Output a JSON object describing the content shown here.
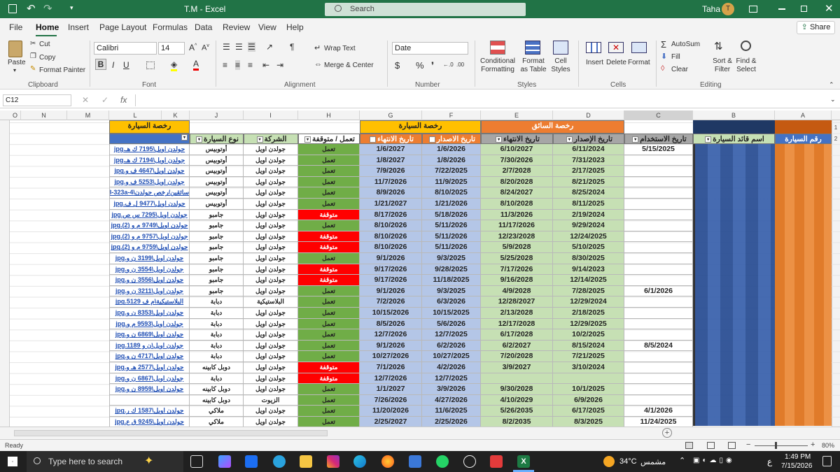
{
  "window": {
    "title": "T.M - Excel",
    "search_placeholder": "Search",
    "user": "Taha",
    "avatar": "T"
  },
  "menu": [
    "File",
    "Home",
    "Insert",
    "Page Layout",
    "Formulas",
    "Data",
    "Review",
    "View",
    "Help"
  ],
  "share": "Share",
  "ribbon": {
    "paste": "Paste",
    "cut": "Cut",
    "copy": "Copy",
    "format_painter": "Format Painter",
    "clipboard": "Clipboard",
    "font_name": "Calibri",
    "font_size": "14",
    "font": "Font",
    "wrap_text": "Wrap Text",
    "merge_center": "Merge & Center",
    "alignment": "Alignment",
    "number_format": "Date",
    "number": "Number",
    "cond_format": "Conditional Formatting",
    "format_table": "Format as Table",
    "cell_styles": "Cell Styles",
    "styles": "Styles",
    "insert": "Insert",
    "delete": "Delete",
    "format": "Format",
    "cells": "Cells",
    "autosum": "AutoSum",
    "fill": "Fill",
    "clear": "Clear",
    "sort_filter": "Sort & Filter",
    "find_select": "Find & Select",
    "editing": "Editing"
  },
  "formula_bar": {
    "name_box": "C12",
    "fx": "fx",
    "content": ""
  },
  "columns": [
    "O",
    "N",
    "M",
    "L",
    "K",
    "J",
    "I",
    "H",
    "G",
    "F",
    "E",
    "D",
    "C",
    "B",
    "A"
  ],
  "row_numbers": [
    "1",
    "2"
  ],
  "headers": {
    "car_license_L": "رخصة السيارة",
    "car_license_G": "رخصة السيارة",
    "driver_license": "رخصة السائق",
    "car_type": "نوع السيارة",
    "company": "الشركة",
    "status": "تعمل / متوقفة",
    "expiry": "تاريخ الانتهاء",
    "issue": "تاريخ الاصدار",
    "driver_expiry": "تاريخ الانتهاء",
    "driver_issue": "تاريخ الإصدار",
    "use_date": "تاريخ الاستخدام",
    "driver_name": "اسم قائد السيارة",
    "car_number": "رقم السيارة"
  },
  "rows": [
    [
      "جولدن اويل\\7195 ك هـ.jpg",
      "أوتوبيس",
      "جولدن اويل",
      "تعمل",
      "1/6/2027",
      "1/6/2026",
      "6/10/2027",
      "6/11/2024",
      "5/15/2025"
    ],
    [
      "جولدن اويل\\7194 ك هـ.jpg",
      "أوتوبيس",
      "جولدن اويل",
      "تعمل",
      "1/8/2027",
      "1/8/2026",
      "7/30/2026",
      "7/31/2023",
      ""
    ],
    [
      "جولدن اويل\\4647 ف و.jpg",
      "أوتوبيس",
      "جولدن اويل",
      "تعمل",
      "7/9/2026",
      "7/22/2025",
      "2/7/2028",
      "2/17/2025",
      ""
    ],
    [
      "جولدن اويل\\5253 ف و.jpg",
      "أوتوبيس",
      "جولدن اويل",
      "تعمل",
      "11/7/2026",
      "11/9/2025",
      "8/20/2028",
      "8/21/2025",
      ""
    ],
    [
      "سائقين/رخص جولدن\\4d8-323a-4",
      "أوتوبيس",
      "جولدن اويل",
      "تعمل",
      "8/9/2026",
      "8/10/2025",
      "8/24/2027",
      "8/25/2024",
      ""
    ],
    [
      "جولدن اويل\\9477 ل ف.jpg",
      "أوتوبيس",
      "جولدن اويل",
      "تعمل",
      "1/21/2027",
      "1/21/2026",
      "8/10/2028",
      "8/11/2025",
      ""
    ],
    [
      "جولدن اويل\\7295 س ص.jpg",
      "جامبو",
      "جولدن اويل",
      "متوقفة",
      "8/17/2026",
      "5/18/2026",
      "11/3/2026",
      "2/19/2024",
      ""
    ],
    [
      "جولدن اويل\\9749 م و (2).jpg",
      "جامبو",
      "جولدن اويل",
      "تعمل",
      "8/10/2026",
      "5/11/2026",
      "11/17/2026",
      "9/29/2024",
      ""
    ],
    [
      "جولدن اويل\\9757 م و (2).jpg",
      "جامبو",
      "جولدن اويل",
      "متوقفة",
      "8/10/2026",
      "5/11/2026",
      "12/23/2028",
      "12/24/2025",
      ""
    ],
    [
      "جولدن اويل\\9759 م و (2).jpg",
      "جامبو",
      "جولدن اويل",
      "متوقفة",
      "8/10/2026",
      "5/11/2026",
      "5/9/2028",
      "5/10/2025",
      ""
    ],
    [
      "جولدن اويل\\3199 ن و.jpg",
      "جامبو",
      "جولدن اويل",
      "تعمل",
      "9/1/2026",
      "9/3/2025",
      "5/25/2028",
      "8/30/2025",
      ""
    ],
    [
      "جولدن اويل\\3554 ن و.jpg",
      "جامبو",
      "جولدن اويل",
      "متوقفة",
      "9/17/2026",
      "9/28/2025",
      "7/17/2026",
      "9/14/2023",
      ""
    ],
    [
      "جولدن اويل\\3556 ن و.jpg",
      "جامبو",
      "جولدن اويل",
      "متوقفة",
      "9/17/2026",
      "11/18/2025",
      "9/16/2028",
      "12/14/2025",
      ""
    ],
    [
      "جولدن اويل\\3211 ن و.jpg",
      "جامبو",
      "جولدن اويل",
      "تعمل",
      "9/1/2026",
      "9/3/2025",
      "4/9/2028",
      "7/28/2025",
      "6/1/2026"
    ],
    [
      "البلاستيكية\\م ف 5129.jpg",
      "دبابة",
      "البلاستيكية",
      "تعمل",
      "7/2/2026",
      "6/3/2026",
      "12/28/2027",
      "12/29/2024",
      ""
    ],
    [
      "جولدن اويل\\8353 ن و.jpg",
      "دبابة",
      "جولدن اويل",
      "تعمل",
      "10/15/2026",
      "10/15/2025",
      "2/13/2028",
      "2/18/2025",
      ""
    ],
    [
      "جولدن اويل\\9593 م و.jpg",
      "دبابة",
      "جولدن اويل",
      "تعمل",
      "8/5/2026",
      "5/6/2026",
      "12/17/2028",
      "12/29/2025",
      ""
    ],
    [
      "جولدن اويل\\6869 ن و.jpg",
      "دبابة",
      "جولدن اويل",
      "تعمل",
      "12/7/2026",
      "12/7/2025",
      "6/17/2028",
      "10/2/2025",
      ""
    ],
    [
      "جولدن اويل\\ن و 1189.jpg",
      "دبابة",
      "جولدن اويل",
      "تعمل",
      "9/1/2026",
      "6/2/2026",
      "6/2/2027",
      "8/15/2024",
      "8/5/2024"
    ],
    [
      "جولدن اويل\\4717 ن و.jpg",
      "دبابة",
      "جولدن اويل",
      "تعمل",
      "10/27/2026",
      "10/27/2025",
      "7/20/2028",
      "7/21/2025",
      ""
    ],
    [
      "جولدن اويل\\2577 هـ و.jpg",
      "دوبل كابينه",
      "جولدن اويل",
      "متوقفة",
      "7/1/2026",
      "4/2/2026",
      "3/9/2027",
      "3/10/2024",
      ""
    ],
    [
      "جولدن اويل\\6867 ن و.jpg",
      "دبابة",
      "جولدن اويل",
      "متوقفة",
      "12/7/2026",
      "12/7/2025",
      "",
      "",
      ""
    ],
    [
      "جولدن اويل\\8959 ن و.jpg",
      "دوبل كابينه",
      "جولدن اويل",
      "تعمل",
      "1/1/2027",
      "3/9/2026",
      "9/30/2028",
      "10/1/2025",
      ""
    ],
    [
      "",
      "دوبل كابينه",
      "الزيوت",
      "تعمل",
      "7/26/2026",
      "4/27/2026",
      "4/10/2029",
      "6/9/2026",
      ""
    ],
    [
      "جولدن اويل\\1587 ك ر.jpg",
      "ملاكي",
      "جولدن اويل",
      "تعمل",
      "11/20/2026",
      "11/6/2025",
      "5/26/2035",
      "6/17/2025",
      "4/1/2026"
    ],
    [
      "جولدن اويل\\9245 ق ع.jpg",
      "ملاكي",
      "جولدن اويل",
      "تعمل",
      "2/25/2027",
      "2/25/2026",
      "8/2/2035",
      "8/3/2025",
      "11/24/2025"
    ]
  ],
  "status_bar": {
    "ready": "Ready",
    "zoom": "80%"
  },
  "taskbar": {
    "search_placeholder": "Type here to search",
    "temperature": "34°C",
    "weather": "مشمس",
    "time": "1:49 PM",
    "date": "7/15/2026",
    "lang": "ع"
  },
  "colors": {
    "excel_green": "#217346",
    "header_yellow": "#ffc000",
    "header_orange": "#ed7d31",
    "header_blue": "#4472c4",
    "light_green": "#c6e0b4",
    "light_blue": "#b4c6e7",
    "status_green": "#70ad47",
    "status_red": "#ff0000"
  }
}
